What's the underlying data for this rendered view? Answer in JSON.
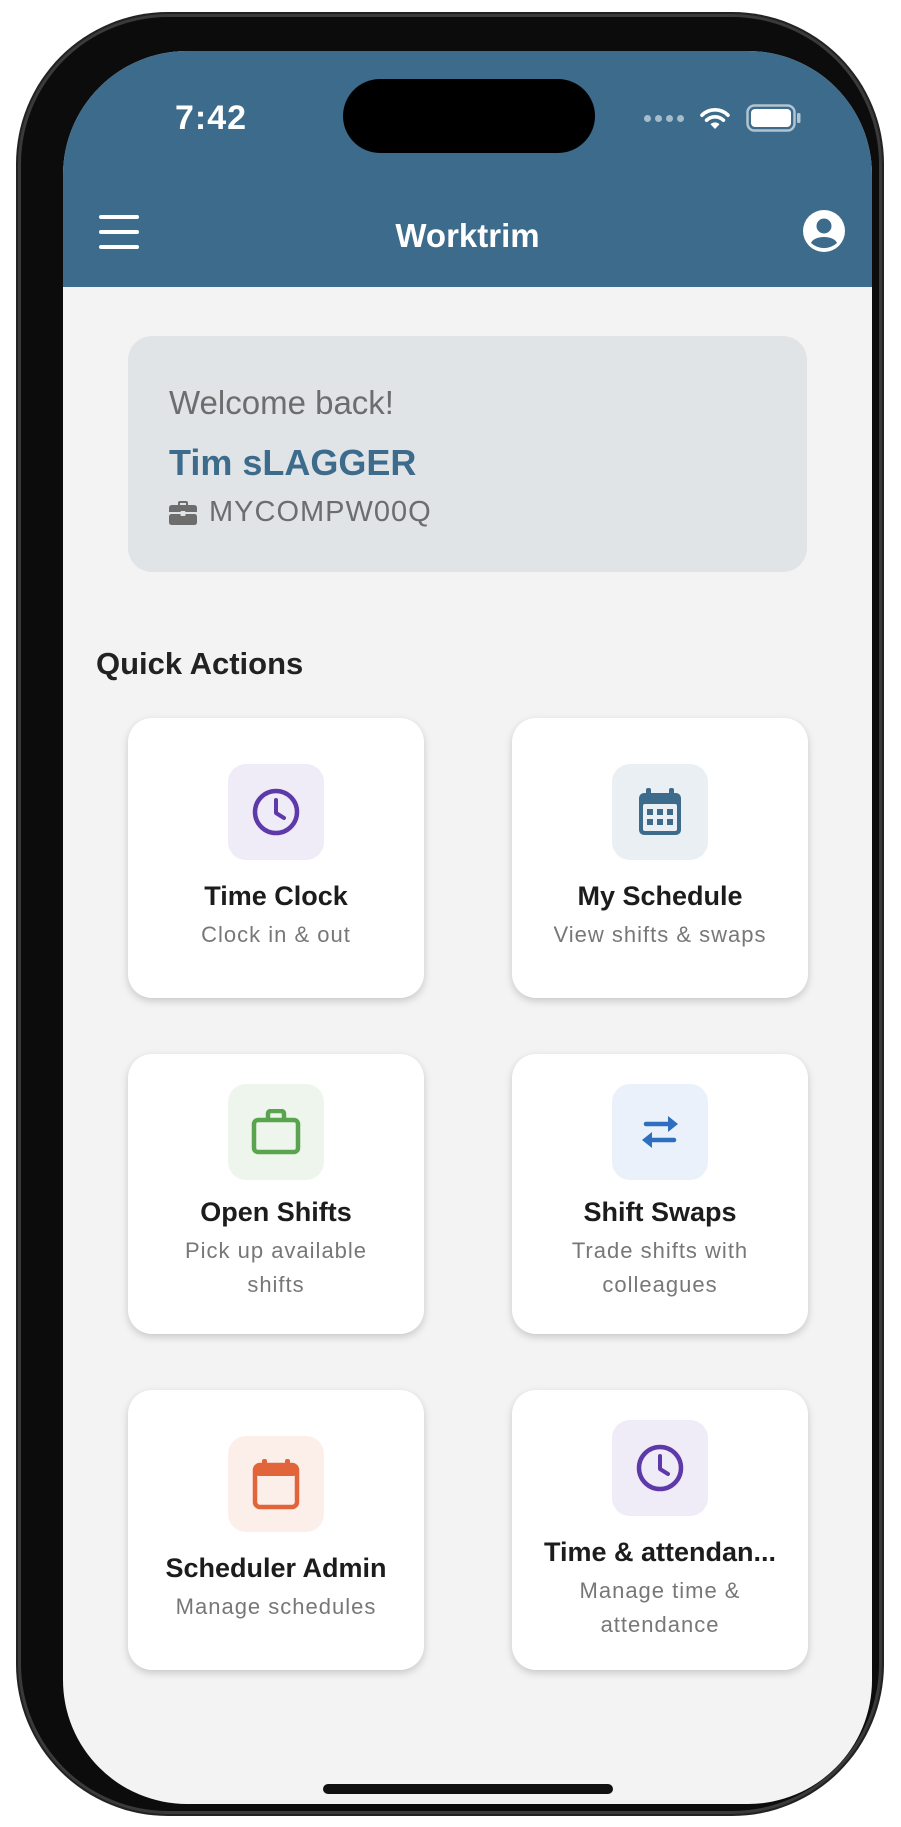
{
  "status_bar": {
    "time": "7:42"
  },
  "header": {
    "title": "Worktrim",
    "menu_icon": "hamburger-menu-icon",
    "profile_icon": "account-circle-icon"
  },
  "welcome": {
    "greeting": "Welcome back!",
    "name": "Tim sLAGGER",
    "company_icon": "briefcase-icon",
    "company": "MYCOMPW00Q"
  },
  "quick_actions": {
    "title": "Quick Actions",
    "tiles": [
      {
        "title": "Time Clock",
        "subtitle": "Clock in & out",
        "icon": "clock-icon",
        "color": "#5e3aa8",
        "bg": "#efebf7"
      },
      {
        "title": "My Schedule",
        "subtitle": "View shifts & swaps",
        "icon": "calendar-icon",
        "color": "#3c6b8c",
        "bg": "#eaeff3"
      },
      {
        "title": "Open Shifts",
        "subtitle": "Pick up available shifts",
        "icon": "briefcase-icon",
        "color": "#5aa44f",
        "bg": "#edf5ec"
      },
      {
        "title": "Shift Swaps",
        "subtitle": "Trade shifts with colleagues",
        "icon": "swap-arrows-icon",
        "color": "#2f6fc0",
        "bg": "#eaf1fa"
      },
      {
        "title": "Scheduler Admin",
        "subtitle": "Manage schedules",
        "icon": "calendar-icon",
        "color": "#e2643a",
        "bg": "#fcefea"
      },
      {
        "title": "Time & attendan...",
        "subtitle": "Manage time & attendance",
        "icon": "clock-icon",
        "color": "#5e3aa8",
        "bg": "#efebf7"
      }
    ]
  }
}
